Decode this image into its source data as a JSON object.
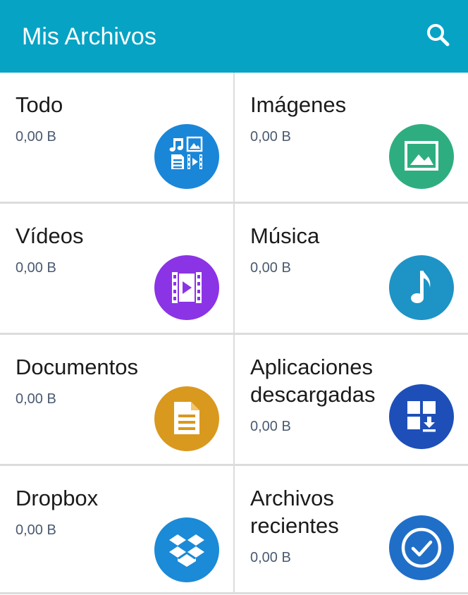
{
  "appbar": {
    "title": "Mis Archivos",
    "search_icon": "search-icon",
    "color": "#06a3c4"
  },
  "categories": [
    {
      "title": "Todo",
      "size": "0,00 B",
      "icon": "all-files-icon",
      "color": "#1a86d8"
    },
    {
      "title": "Imágenes",
      "size": "0,00 B",
      "icon": "image-icon",
      "color": "#2eae80"
    },
    {
      "title": "Vídeos",
      "size": "0,00 B",
      "icon": "video-icon",
      "color": "#8b34e6"
    },
    {
      "title": "Música",
      "size": "0,00 B",
      "icon": "music-note-icon",
      "color": "#1e93c6"
    },
    {
      "title": "Documentos",
      "size": "0,00 B",
      "icon": "document-icon",
      "color": "#d9991f"
    },
    {
      "title": "Aplicaciones descargadas",
      "size": "0,00 B",
      "icon": "download-apps-icon",
      "color": "#1e4fb9"
    },
    {
      "title": "Dropbox",
      "size": "0,00 B",
      "icon": "dropbox-icon",
      "color": "#1b8ad7"
    },
    {
      "title": "Archivos recientes",
      "size": "0,00 B",
      "icon": "recent-clock-icon",
      "color": "#1f6fc8"
    }
  ]
}
